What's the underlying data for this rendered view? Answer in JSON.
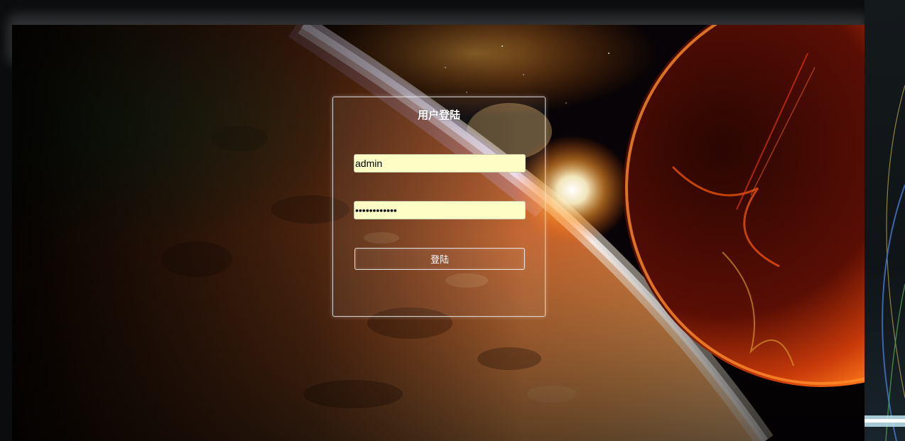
{
  "login": {
    "title": "用户登陆",
    "username_value": "admin",
    "password_value": "••••••••••••",
    "submit_label": "登陆"
  },
  "colors": {
    "field_background": "#fcfec6",
    "page_background": "#0b0c0e",
    "panel_border": "#ebebeb"
  },
  "background": {
    "image": "space-planet-sunrise"
  }
}
